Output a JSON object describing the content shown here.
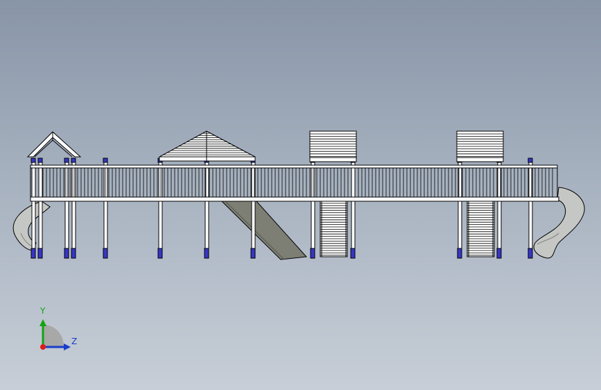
{
  "viewport": {
    "background_top": "#8895a7",
    "background_bottom": "#c7ced7"
  },
  "model": {
    "description_colors": {
      "outline": "#000000",
      "frame_fill": "#ffffff",
      "foot_fill": "#3636c8",
      "slide_fill": "#7d7f74",
      "spiral_fill": "#c4c7c3"
    }
  },
  "triad": {
    "y_label": "Y",
    "z_label": "Z",
    "y_color": "#12a312",
    "z_color": "#1a3ccc",
    "origin_color": "#e01a1a"
  }
}
